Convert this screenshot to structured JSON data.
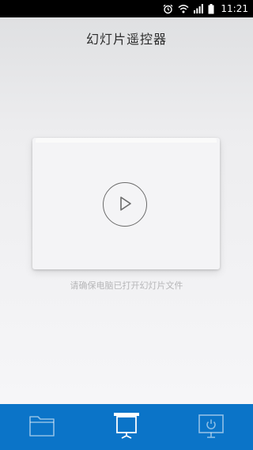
{
  "status_bar": {
    "time": "11:21",
    "icons": [
      "alarm-icon",
      "wifi-icon",
      "signal-icon",
      "battery-icon"
    ]
  },
  "header": {
    "title": "幻灯片遥控器"
  },
  "main": {
    "hint": "请确保电脑已打开幻灯片文件",
    "play_icon": "play-circle-icon"
  },
  "bottom_nav": {
    "tabs": [
      {
        "icon": "folder-icon",
        "active": false
      },
      {
        "icon": "presentation-screen-icon",
        "active": true
      },
      {
        "icon": "power-monitor-icon",
        "active": false
      }
    ]
  },
  "colors": {
    "accent": "#0b74c8",
    "status_bar": "#000000",
    "hint_text": "#b6b6b8"
  }
}
